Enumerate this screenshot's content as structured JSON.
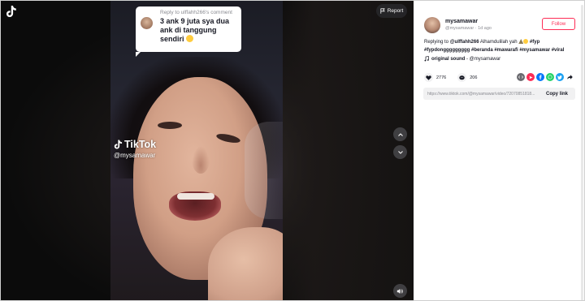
{
  "player": {
    "report_label": "Report",
    "reply_header": "Reply to ulffahh266's comment",
    "reply_text": "3 ank 9 juta sya dua ank di tanggung sendiri",
    "watermark_brand": "TikTok",
    "watermark_user": "@mysamawar"
  },
  "panel": {
    "username": "mysamawar",
    "handle_time": "@mysamawar · 1d ago",
    "follow_label": "Follow",
    "caption_prefix": "Replying to ",
    "caption_mention": "@ulffahh266",
    "caption_text": " Alhamdulilah yah ",
    "hashtags_line1": "#fyp",
    "hashtags_line2": "#fypdonggggggggg #beranda #mawarafi #mysamawar #viral",
    "sound_label": "original sound",
    "sound_owner": " - @mysamawar",
    "likes": "2776",
    "comments": "206",
    "link_url": "https://www.tiktok.com/@mysamawar/video/72070851818...",
    "copy_label": "Copy link"
  },
  "colors": {
    "accent": "#fe2c55",
    "text": "#161823",
    "muted": "#8a8b91"
  },
  "icons": [
    "tiktok-logo-icon",
    "flag-icon",
    "chevron-up-icon",
    "chevron-down-icon",
    "volume-icon",
    "music-note-icon",
    "heart-icon",
    "comment-icon",
    "embed-icon",
    "send-icon",
    "facebook-icon",
    "whatsapp-icon",
    "twitter-icon",
    "share-arrow-icon"
  ]
}
